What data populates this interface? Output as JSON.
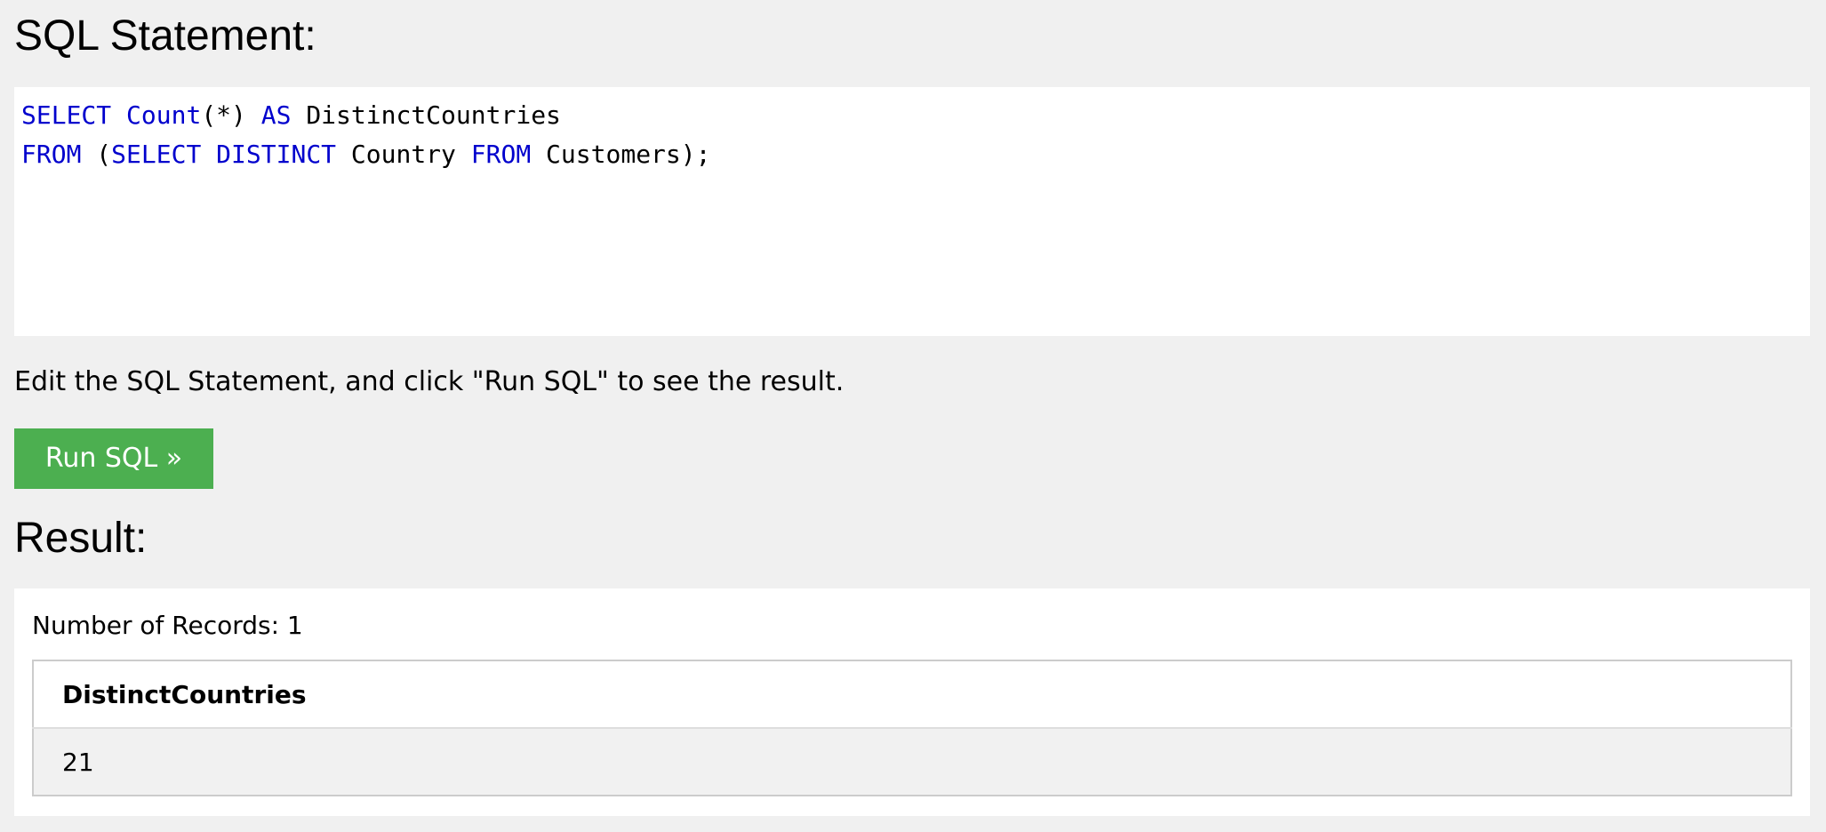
{
  "headings": {
    "sql_statement": "SQL Statement:",
    "result": "Result:"
  },
  "editor": {
    "lines": [
      [
        {
          "text": "SELECT",
          "kind": "keyword"
        },
        {
          "text": " ",
          "kind": "plain"
        },
        {
          "text": "Count",
          "kind": "keyword"
        },
        {
          "text": "(*) ",
          "kind": "plain"
        },
        {
          "text": "AS",
          "kind": "keyword"
        },
        {
          "text": " DistinctCountries",
          "kind": "plain"
        }
      ],
      [
        {
          "text": "FROM",
          "kind": "keyword"
        },
        {
          "text": " (",
          "kind": "plain"
        },
        {
          "text": "SELECT",
          "kind": "keyword"
        },
        {
          "text": " ",
          "kind": "plain"
        },
        {
          "text": "DISTINCT",
          "kind": "keyword"
        },
        {
          "text": " Country ",
          "kind": "plain"
        },
        {
          "text": "FROM",
          "kind": "keyword"
        },
        {
          "text": " Customers);",
          "kind": "plain"
        }
      ]
    ],
    "keyword_color": "#0000cd"
  },
  "instructions": "Edit the SQL Statement, and click \"Run SQL\" to see the result.",
  "run_button": {
    "label": "Run SQL »",
    "color": "#4caf50"
  },
  "result": {
    "record_count_text": "Number of Records: 1",
    "columns": [
      "DistinctCountries"
    ],
    "rows": [
      [
        "21"
      ]
    ]
  }
}
